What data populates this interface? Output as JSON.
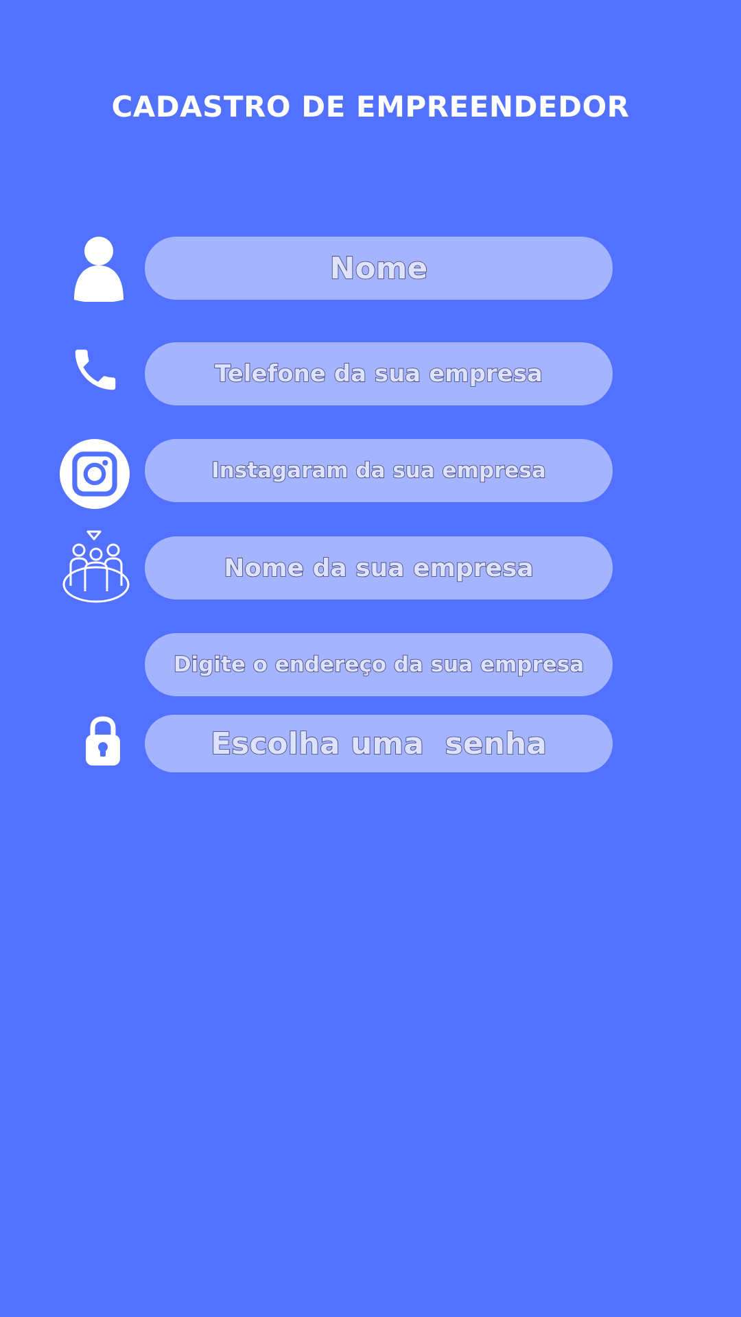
{
  "page": {
    "title": "CADASTRO DE EMPREENDEDOR"
  },
  "form": {
    "fields": [
      {
        "label": "Nome",
        "icon": "person-icon"
      },
      {
        "label": "Telefone da sua empresa",
        "icon": "phone-icon"
      },
      {
        "label": "Instagaram da sua empresa",
        "icon": "instagram-icon"
      },
      {
        "label": "Nome da sua empresa",
        "icon": "team-icon"
      },
      {
        "label": "Digite o endereço da sua empresa",
        "icon": ""
      },
      {
        "label": "Escolha uma  senha",
        "icon": "lock-icon"
      }
    ]
  },
  "colors": {
    "background": "#5271ff",
    "field_fill": "#a5b4ff",
    "label_fill": "#dde2ff",
    "label_outline": "#3d3d6a",
    "icon": "#ffffff"
  }
}
